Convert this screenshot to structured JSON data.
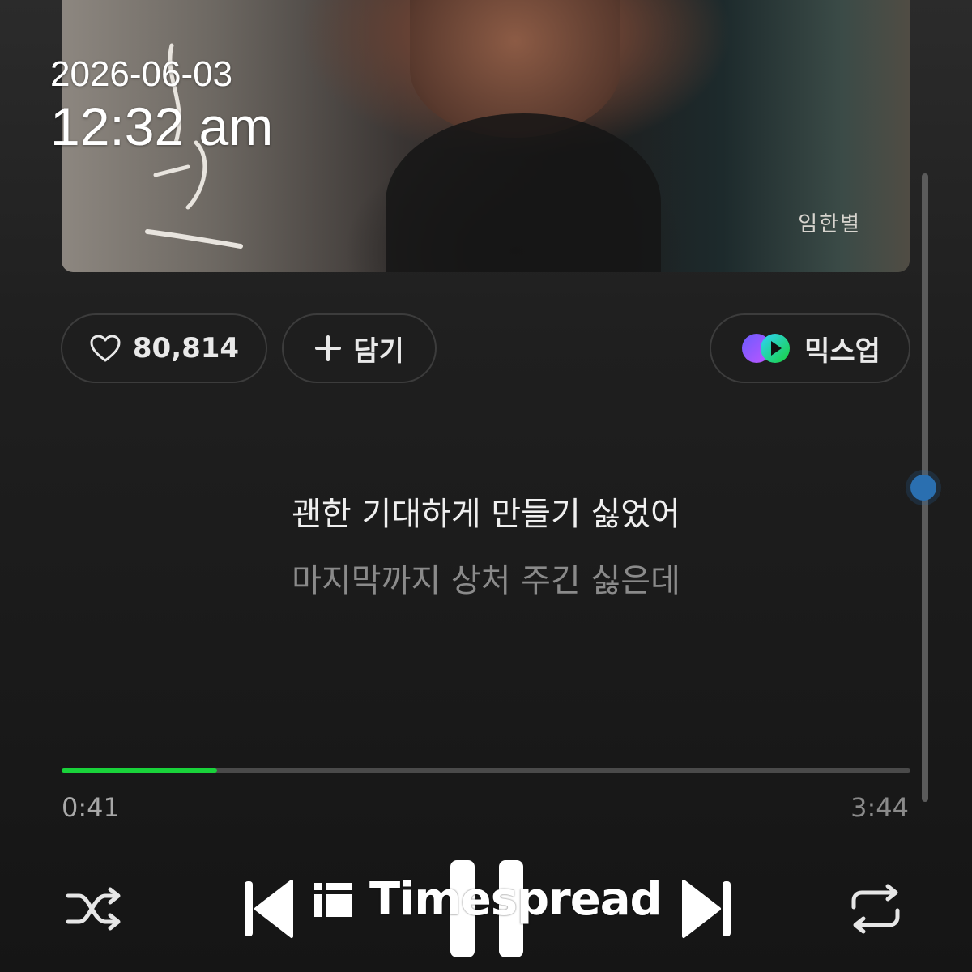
{
  "overlay": {
    "date": "2026-06-03",
    "time": "12:32 am"
  },
  "album": {
    "artist_signature": "임한별"
  },
  "actions": {
    "like_count": "80,814",
    "add_label": "담기",
    "mixup_label": "믹스업"
  },
  "lyrics": {
    "current": "괜한 기대하게 만들기 싫었어",
    "next": "마지막까지 상처 주긴 싫은데"
  },
  "playback": {
    "elapsed": "0:41",
    "total": "3:44",
    "progress": 0.183
  },
  "watermark": {
    "text": "Timespread"
  },
  "colors": {
    "accent": "#19d23a",
    "scroll_thumb": "#2a6fb0"
  },
  "icons": {
    "like": "heart-icon",
    "add": "plus-icon",
    "mixup": "mixup-icon",
    "shuffle": "shuffle-icon",
    "previous": "skip-previous-icon",
    "pause": "pause-icon",
    "next": "skip-next-icon",
    "repeat": "repeat-icon"
  }
}
